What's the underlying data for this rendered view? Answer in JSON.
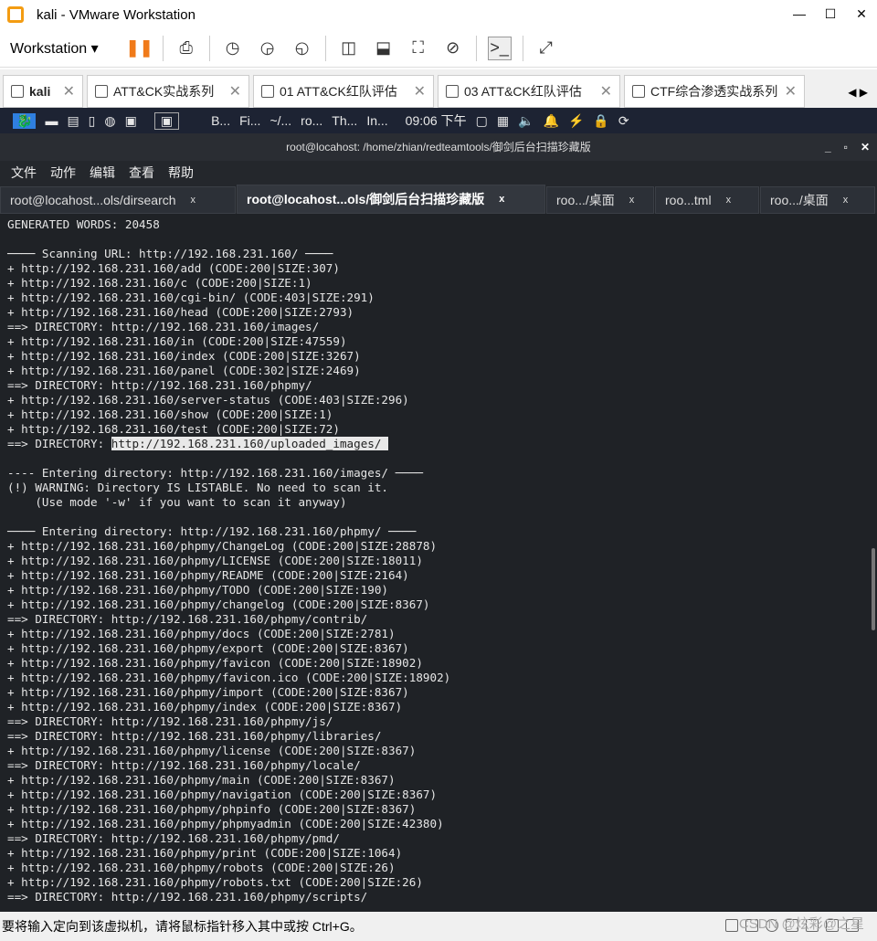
{
  "window": {
    "title": "kali - VMware Workstation",
    "min": "—",
    "max": "☐",
    "close": "✕"
  },
  "toolbar": {
    "workstation": "Workstation ▾"
  },
  "vm_tabs": [
    {
      "label": "kali"
    },
    {
      "label": "ATT&CK实战系列"
    },
    {
      "label": "01 ATT&CK红队评估"
    },
    {
      "label": "03 ATT&CK红队评估"
    },
    {
      "label": "CTF综合渗透实战系列"
    }
  ],
  "panel": {
    "tasks": [
      "B...",
      "Fi...",
      "~/...",
      "ro...",
      "Th...",
      "In..."
    ],
    "clock": "09:06 下午"
  },
  "terminal": {
    "title": "root@locahost: /home/zhian/redteamtools/御剑后台扫描珍藏版",
    "menu": [
      "文件",
      "动作",
      "编辑",
      "查看",
      "帮助"
    ],
    "tabs": [
      {
        "label": "root@locahost...ols/dirsearch",
        "active": false
      },
      {
        "label": "root@locahost...ols/御剑后台扫描珍藏版",
        "active": true
      },
      {
        "label": "roo.../桌面",
        "active": false
      },
      {
        "label": "roo...tml",
        "active": false
      },
      {
        "label": "roo.../桌面",
        "active": false
      }
    ],
    "lines": [
      "GENERATED WORDS: 20458",
      "",
      "──── Scanning URL: http://192.168.231.160/ ────",
      "+ http://192.168.231.160/add (CODE:200|SIZE:307)",
      "+ http://192.168.231.160/c (CODE:200|SIZE:1)",
      "+ http://192.168.231.160/cgi-bin/ (CODE:403|SIZE:291)",
      "+ http://192.168.231.160/head (CODE:200|SIZE:2793)",
      "==> DIRECTORY: http://192.168.231.160/images/",
      "+ http://192.168.231.160/in (CODE:200|SIZE:47559)",
      "+ http://192.168.231.160/index (CODE:200|SIZE:3267)",
      "+ http://192.168.231.160/panel (CODE:302|SIZE:2469)",
      "==> DIRECTORY: http://192.168.231.160/phpmy/",
      "+ http://192.168.231.160/server-status (CODE:403|SIZE:296)",
      "+ http://192.168.231.160/show (CODE:200|SIZE:1)",
      "+ http://192.168.231.160/test (CODE:200|SIZE:72)",
      "==> DIRECTORY: ",
      "",
      "---- Entering directory: http://192.168.231.160/images/ ────",
      "(!) WARNING: Directory IS LISTABLE. No need to scan it.",
      "    (Use mode '-w' if you want to scan it anyway)",
      "",
      "──── Entering directory: http://192.168.231.160/phpmy/ ────",
      "+ http://192.168.231.160/phpmy/ChangeLog (CODE:200|SIZE:28878)",
      "+ http://192.168.231.160/phpmy/LICENSE (CODE:200|SIZE:18011)",
      "+ http://192.168.231.160/phpmy/README (CODE:200|SIZE:2164)",
      "+ http://192.168.231.160/phpmy/TODO (CODE:200|SIZE:190)",
      "+ http://192.168.231.160/phpmy/changelog (CODE:200|SIZE:8367)",
      "==> DIRECTORY: http://192.168.231.160/phpmy/contrib/",
      "+ http://192.168.231.160/phpmy/docs (CODE:200|SIZE:2781)",
      "+ http://192.168.231.160/phpmy/export (CODE:200|SIZE:8367)",
      "+ http://192.168.231.160/phpmy/favicon (CODE:200|SIZE:18902)",
      "+ http://192.168.231.160/phpmy/favicon.ico (CODE:200|SIZE:18902)",
      "+ http://192.168.231.160/phpmy/import (CODE:200|SIZE:8367)",
      "+ http://192.168.231.160/phpmy/index (CODE:200|SIZE:8367)",
      "==> DIRECTORY: http://192.168.231.160/phpmy/js/",
      "==> DIRECTORY: http://192.168.231.160/phpmy/libraries/",
      "+ http://192.168.231.160/phpmy/license (CODE:200|SIZE:8367)",
      "==> DIRECTORY: http://192.168.231.160/phpmy/locale/",
      "+ http://192.168.231.160/phpmy/main (CODE:200|SIZE:8367)",
      "+ http://192.168.231.160/phpmy/navigation (CODE:200|SIZE:8367)",
      "+ http://192.168.231.160/phpmy/phpinfo (CODE:200|SIZE:8367)",
      "+ http://192.168.231.160/phpmy/phpmyadmin (CODE:200|SIZE:42380)",
      "==> DIRECTORY: http://192.168.231.160/phpmy/pmd/",
      "+ http://192.168.231.160/phpmy/print (CODE:200|SIZE:1064)",
      "+ http://192.168.231.160/phpmy/robots (CODE:200|SIZE:26)",
      "+ http://192.168.231.160/phpmy/robots.txt (CODE:200|SIZE:26)",
      "==> DIRECTORY: http://192.168.231.160/phpmy/scripts/"
    ],
    "selected_text": "http://192.168.231.160/uploaded_images/ "
  },
  "statusbar": {
    "message": "要将输入定向到该虚拟机，请将鼠标指针移入其中或按 Ctrl+G。",
    "watermark": "CSDN @炫彩@之星"
  }
}
